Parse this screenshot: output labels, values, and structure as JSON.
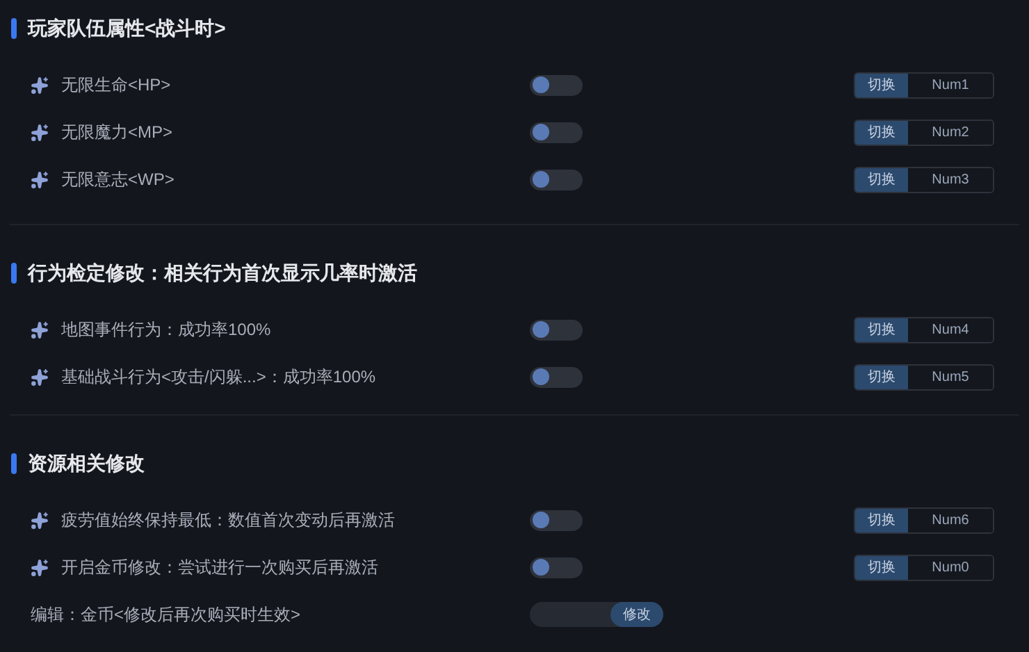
{
  "sections": [
    {
      "title": "玩家队伍属性<战斗时>",
      "items": [
        {
          "kind": "toggle",
          "label": "无限生命<HP>",
          "on": false,
          "switch_label": "切换",
          "hotkey": "Num1"
        },
        {
          "kind": "toggle",
          "label": "无限魔力<MP>",
          "on": false,
          "switch_label": "切换",
          "hotkey": "Num2"
        },
        {
          "kind": "toggle",
          "label": "无限意志<WP>",
          "on": false,
          "switch_label": "切换",
          "hotkey": "Num3"
        }
      ]
    },
    {
      "title": "行为检定修改：相关行为首次显示几率时激活",
      "items": [
        {
          "kind": "toggle",
          "label": "地图事件行为：成功率100%",
          "on": false,
          "switch_label": "切换",
          "hotkey": "Num4"
        },
        {
          "kind": "toggle",
          "label": "基础战斗行为<攻击/闪躲...>：成功率100%",
          "on": false,
          "switch_label": "切换",
          "hotkey": "Num5"
        }
      ]
    },
    {
      "title": "资源相关修改",
      "items": [
        {
          "kind": "toggle",
          "label": "疲劳值始终保持最低：数值首次变动后再激活",
          "on": false,
          "switch_label": "切换",
          "hotkey": "Num6"
        },
        {
          "kind": "toggle",
          "label": "开启金币修改：尝试进行一次购买后再激活",
          "on": false,
          "switch_label": "切换",
          "hotkey": "Num0"
        },
        {
          "kind": "edit",
          "label": "编辑：金币<修改后再次购买时生效>",
          "button": "修改"
        }
      ]
    }
  ]
}
